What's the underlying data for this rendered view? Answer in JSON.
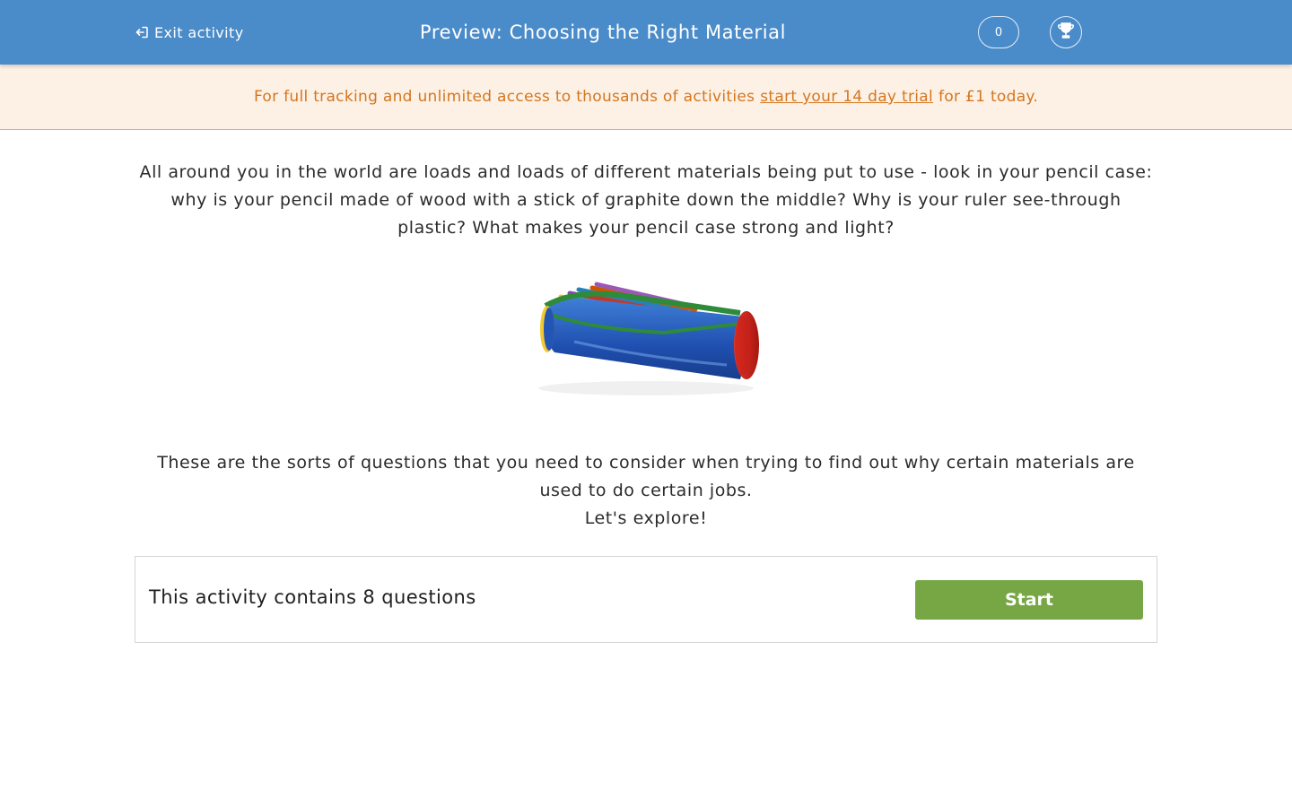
{
  "header": {
    "exit_label": "Exit activity",
    "exit_icon": "exit-icon",
    "title": "Preview: Choosing the Right Material",
    "score": "0",
    "trophy_icon": "trophy-icon",
    "background_color": "#4a8bc9"
  },
  "banner": {
    "text_before": "For full tracking and unlimited access to thousands of activities",
    "link_text": "start your 14 day trial",
    "text_after": "for £1 today.",
    "text_color": "#d4761f",
    "background_color": "#fdf1e5"
  },
  "intro": {
    "paragraph": "All around you in the world are loads and loads of different materials being put to use - look in your pencil case: why is your pencil made of wood with a stick of graphite down the middle? Why is your ruler see-through plastic? What makes your pencil case strong and light?"
  },
  "image": {
    "icon": "pencil-case-image"
  },
  "outro": {
    "line1": "These are the sorts of questions that you need to consider when trying to find out why certain materials are used to do certain jobs.",
    "line2": "Let's explore!"
  },
  "activity": {
    "count_text": "This activity contains 8 questions",
    "start_label": "Start",
    "start_color": "#76a744"
  }
}
